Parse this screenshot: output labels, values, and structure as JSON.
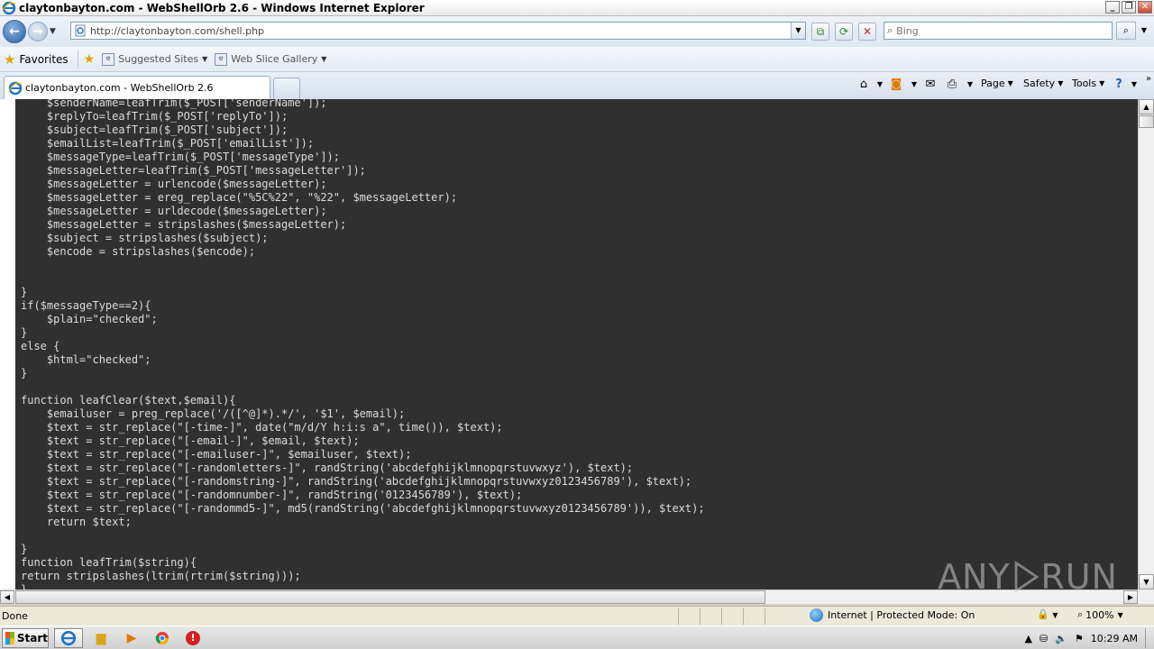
{
  "window": {
    "title": "claytonbayton.com - WebShellOrb 2.6 - Windows Internet Explorer",
    "minimize": "_",
    "restore": "❐",
    "close": "✕"
  },
  "address": {
    "url_host": "http://claytonbayton.com",
    "url_path": "/shell.php"
  },
  "search": {
    "placeholder": "Bing"
  },
  "favorites": {
    "label": "Favorites",
    "items": [
      {
        "label": "Suggested Sites"
      },
      {
        "label": "Web Slice Gallery"
      }
    ]
  },
  "tab": {
    "title": "claytonbayton.com - WebShellOrb 2.6"
  },
  "commands": {
    "page": "Page",
    "safety": "Safety",
    "tools": "Tools"
  },
  "code_lines": [
    "    $senderName=leafTrim($_POST['senderName']);",
    "    $replyTo=leafTrim($_POST['replyTo']);",
    "    $subject=leafTrim($_POST['subject']);",
    "    $emailList=leafTrim($_POST['emailList']);",
    "    $messageType=leafTrim($_POST['messageType']);",
    "    $messageLetter=leafTrim($_POST['messageLetter']);",
    "    $messageLetter = urlencode($messageLetter);",
    "    $messageLetter = ereg_replace(\"%5C%22\", \"%22\", $messageLetter);",
    "    $messageLetter = urldecode($messageLetter);",
    "    $messageLetter = stripslashes($messageLetter);",
    "    $subject = stripslashes($subject);",
    "    $encode = stripslashes($encode);",
    "",
    "",
    "}",
    "if($messageType==2){",
    "    $plain=\"checked\";",
    "}",
    "else {",
    "    $html=\"checked\";",
    "}",
    "",
    "function leafClear($text,$email){",
    "    $emailuser = preg_replace('/([^@]*).*/', '$1', $email);",
    "    $text = str_replace(\"[-time-]\", date(\"m/d/Y h:i:s a\", time()), $text);",
    "    $text = str_replace(\"[-email-]\", $email, $text);",
    "    $text = str_replace(\"[-emailuser-]\", $emailuser, $text);",
    "    $text = str_replace(\"[-randomletters-]\", randString('abcdefghijklmnopqrstuvwxyz'), $text);",
    "    $text = str_replace(\"[-randomstring-]\", randString('abcdefghijklmnopqrstuvwxyz0123456789'), $text);",
    "    $text = str_replace(\"[-randomnumber-]\", randString('0123456789'), $text);",
    "    $text = str_replace(\"[-randommd5-]\", md5(randString('abcdefghijklmnopqrstuvwxyz0123456789')), $text);",
    "    return $text;",
    "",
    "}",
    "function leafTrim($string){",
    "return stripslashes(ltrim(rtrim($string)));",
    "}"
  ],
  "watermark": {
    "left": "ANY",
    "right": "RUN"
  },
  "status": {
    "text": "Done",
    "zone": "Internet | Protected Mode: On",
    "zoom": "100%"
  },
  "taskbar": {
    "start": "Start",
    "clock": "10:29 AM"
  }
}
